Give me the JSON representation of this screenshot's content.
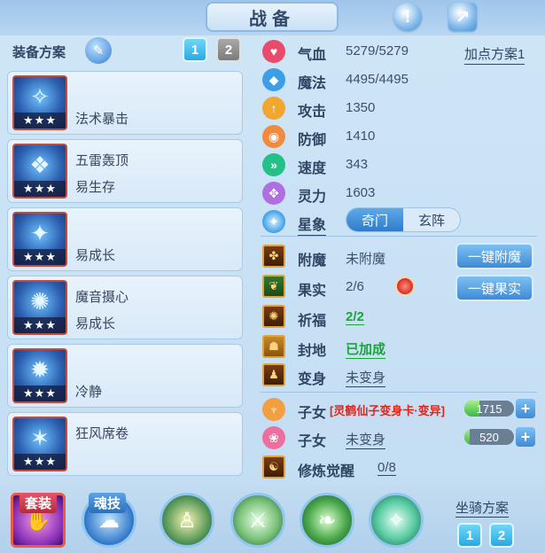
{
  "title": "战备",
  "top_icons": {
    "info": "!",
    "share": "↗"
  },
  "equip_plan": {
    "label": "装备方案",
    "plans": [
      "1",
      "2"
    ]
  },
  "equipment": [
    {
      "lines": [
        "",
        "法术暴击"
      ],
      "stars": "★★★",
      "glyph": "✧"
    },
    {
      "lines": [
        "五雷轰顶",
        "易生存"
      ],
      "stars": "★★★",
      "glyph": "❖"
    },
    {
      "lines": [
        "",
        "易成长"
      ],
      "stars": "★★★",
      "glyph": "✦"
    },
    {
      "lines": [
        "魔音摄心",
        "易成长"
      ],
      "stars": "★★★",
      "glyph": "✺"
    },
    {
      "lines": [
        "",
        "冷静"
      ],
      "stars": "★★★",
      "glyph": "✹"
    },
    {
      "lines": [
        "狂风席卷",
        ""
      ],
      "stars": "★★★",
      "glyph": "✶"
    }
  ],
  "stats": [
    {
      "name": "气血",
      "value": "5279/5279",
      "icon": "♥",
      "color": "#e84b6b"
    },
    {
      "name": "魔法",
      "value": "4495/4495",
      "icon": "◆",
      "color": "#3d9ee8"
    },
    {
      "name": "攻击",
      "value": "1350",
      "icon": "↑",
      "color": "#f0a72f"
    },
    {
      "name": "防御",
      "value": "1410",
      "icon": "◉",
      "color": "#f08a3c"
    },
    {
      "name": "速度",
      "value": "343",
      "icon": "»",
      "color": "#25c08a"
    },
    {
      "name": "灵力",
      "value": "1603",
      "icon": "✥",
      "color": "#b06fe0"
    }
  ],
  "add_point_plan": "加点方案1",
  "star_sign": {
    "label": "星象",
    "tabs": [
      "奇门",
      "玄阵"
    ]
  },
  "features": [
    {
      "name": "附魔",
      "value": "未附魔",
      "style": "plain"
    },
    {
      "name": "果实",
      "value": "2/6",
      "style": "plain"
    },
    {
      "name": "祈福",
      "value": "2/2",
      "style": "green"
    },
    {
      "name": "封地",
      "value": "已加成",
      "style": "green"
    },
    {
      "name": "变身",
      "value": "未变身",
      "style": "underline"
    }
  ],
  "actions": {
    "enchant": "一键附魔",
    "fruit": "一键果实"
  },
  "children": [
    {
      "name": "子女",
      "value": "[灵鹤仙子变身卡·变异]",
      "bar_value": "1715",
      "bar_fraction": 0.3
    },
    {
      "name": "子女",
      "value": "未变身",
      "bar_value": "520",
      "bar_fraction": 0.1
    }
  ],
  "cultivation": {
    "name": "修炼觉醒",
    "value": "0/8"
  },
  "bottom": {
    "set_label": "套装",
    "soul_label": "魂技",
    "mount_label": "坐骑方案",
    "mount_plans": [
      "1",
      "2"
    ]
  }
}
